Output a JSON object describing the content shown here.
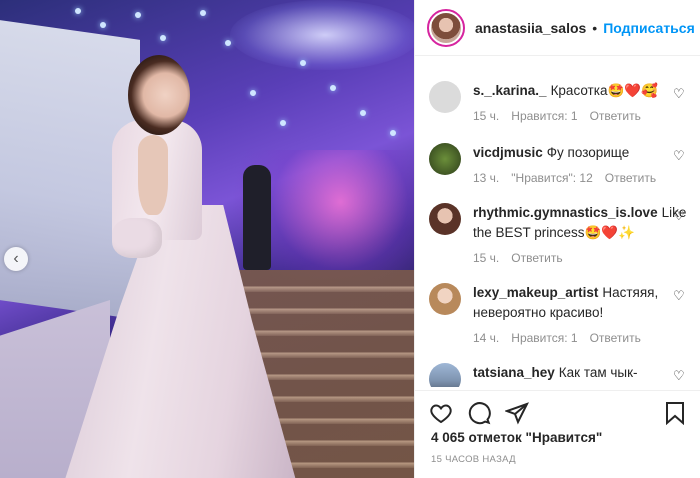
{
  "post": {
    "author": "anastasiia_salos",
    "dot": "•",
    "follow_label": "Подписаться",
    "likes_text": "4 065 отметок \"Нравится\"",
    "time_text": "15 ЧАСОВ НАЗАД"
  },
  "comments": [
    {
      "user": "s._.karina._",
      "text": "Красотка🤩❤️🥰",
      "age": "15 ч.",
      "likes": "Нравится: 1",
      "reply": "Ответить"
    },
    {
      "user": "vicdjmusic",
      "text": "Фу позорище",
      "age": "13 ч.",
      "likes": "\"Нравится\": 12",
      "reply": "Ответить"
    },
    {
      "user": "rhythmic.gymnastics_is.love",
      "text": "Like the BEST princess🤩❤️✨",
      "age": "15 ч.",
      "likes": "",
      "reply": "Ответить"
    },
    {
      "user": "lexy_makeup_artist",
      "text": "Настяяя, невероятно красиво!",
      "age": "14 ч.",
      "likes": "Нравится: 1",
      "reply": "Ответить"
    },
    {
      "user": "tatsiana_hey",
      "text": "Как там чык-чырык?",
      "age": "",
      "likes": "",
      "reply": ""
    }
  ],
  "colors": {
    "accent": "#0095f6",
    "text": "#262626",
    "muted": "#8e8e8e"
  },
  "icons": [
    "chevron-left-icon",
    "heart-icon",
    "comment-icon",
    "share-icon",
    "bookmark-icon"
  ]
}
